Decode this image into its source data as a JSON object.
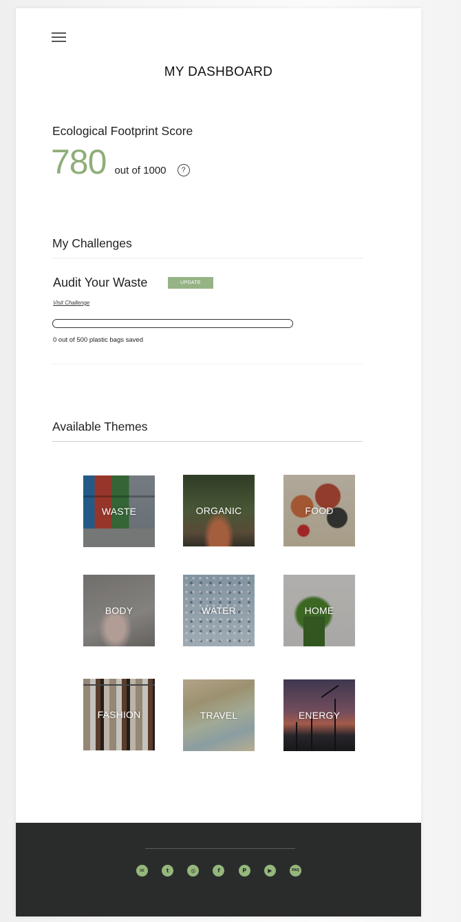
{
  "header": {
    "title": "MY DASHBOARD"
  },
  "score": {
    "heading": "Ecological Footprint Score",
    "value": "780",
    "out_of": "out of 1000",
    "help_symbol": "?"
  },
  "challenges": {
    "heading": "My Challenges",
    "items": [
      {
        "name": "Audit Your Waste",
        "update_label": "UPDATE",
        "visit_link": "Visit Challenge",
        "progress_fraction": 0,
        "progress_text": "0 out of 500 plastic bags saved"
      }
    ]
  },
  "themes": {
    "heading": "Available Themes",
    "items": [
      {
        "label": "WASTE",
        "image": "waste-bins-photo"
      },
      {
        "label": "ORGANIC",
        "image": "garden-path-photo"
      },
      {
        "label": "FOOD",
        "image": "jars-strawberries-photo"
      },
      {
        "label": "BODY",
        "image": "hand-soap-photo"
      },
      {
        "label": "WATER",
        "image": "water-droplets-photo"
      },
      {
        "label": "HOME",
        "image": "house-plant-photo"
      },
      {
        "label": "FASHION",
        "image": "clothing-rack-photo"
      },
      {
        "label": "TRAVEL",
        "image": "map-photo"
      },
      {
        "label": "ENERGY",
        "image": "wind-turbines-photo"
      }
    ]
  },
  "footer": {
    "social_icons": [
      {
        "name": "email-icon",
        "glyph": "✉"
      },
      {
        "name": "twitter-icon",
        "glyph": "t"
      },
      {
        "name": "instagram-icon",
        "glyph": "◎"
      },
      {
        "name": "facebook-icon",
        "glyph": "f"
      },
      {
        "name": "pinterest-icon",
        "glyph": "P"
      },
      {
        "name": "youtube-icon",
        "glyph": "▶"
      },
      {
        "name": "faq-icon",
        "glyph": "FAQ"
      }
    ]
  },
  "colors": {
    "accent_green": "#96b386",
    "score_green": "#8fae79",
    "footer_bg": "#2a2c2b",
    "icon_green": "#95b77c"
  }
}
